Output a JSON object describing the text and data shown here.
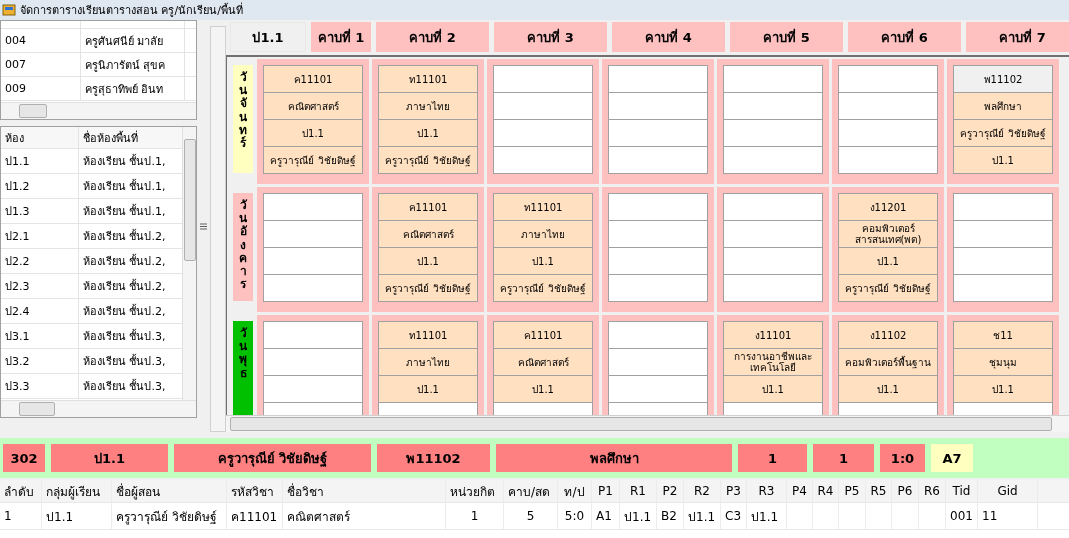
{
  "window": {
    "title": "จัดการตารางเรียนตารางสอน ครู/นักเรียน/พื้นที่"
  },
  "teachers": {
    "rows": [
      {
        "code": "004",
        "name": "ครูศันศนีย์ มาลัย"
      },
      {
        "code": "007",
        "name": "ครูนิภารัตน์ สุขค"
      },
      {
        "code": "009",
        "name": "ครูสุธาทิพย์ อินท"
      }
    ]
  },
  "rooms": {
    "columns": [
      "ห้อง",
      "ชื่อห้องพื้นที่"
    ],
    "rows": [
      {
        "code": "ป1.1",
        "name": "ห้องเรียน ชั้นป.1,"
      },
      {
        "code": "ป1.2",
        "name": "ห้องเรียน ชั้นป.1,"
      },
      {
        "code": "ป1.3",
        "name": "ห้องเรียน ชั้นป.1,"
      },
      {
        "code": "ป2.1",
        "name": "ห้องเรียน ชั้นป.2,"
      },
      {
        "code": "ป2.2",
        "name": "ห้องเรียน ชั้นป.2,"
      },
      {
        "code": "ป2.3",
        "name": "ห้องเรียน ชั้นป.2,"
      },
      {
        "code": "ป2.4",
        "name": "ห้องเรียน ชั้นป.2,"
      },
      {
        "code": "ป3.1",
        "name": "ห้องเรียน ชั้นป.3,"
      },
      {
        "code": "ป3.2",
        "name": "ห้องเรียน ชั้นป.3,"
      },
      {
        "code": "ป3.3",
        "name": "ห้องเรียน ชั้นป.3,"
      }
    ]
  },
  "timetable": {
    "group": "ป1.1",
    "periods": [
      "คาบที่ 1",
      "คาบที่ 2",
      "คาบที่ 3",
      "คาบที่ 4",
      "คาบที่ 5",
      "คาบที่ 6",
      "คาบที่ 7"
    ],
    "days": [
      {
        "label": "วันจันทร์",
        "color": "#ffffc0",
        "slots": [
          {
            "kind": "lesson",
            "selected": false,
            "lines": [
              "ค11101",
              "คณิตศาสตร์",
              "ป1.1",
              "ครูวารุณีย์ วิชัยดิษฐ์"
            ]
          },
          {
            "kind": "lesson",
            "selected": false,
            "lines": [
              "ท11101",
              "ภาษาไทย",
              "ป1.1",
              "ครูวารุณีย์ วิชัยดิษฐ์"
            ]
          },
          {
            "kind": "empty",
            "selected": false
          },
          {
            "kind": "empty",
            "selected": false
          },
          {
            "kind": "empty",
            "selected": false
          },
          {
            "kind": "empty",
            "selected": false
          },
          {
            "kind": "lesson",
            "selected": true,
            "lines": [
              "พ11102",
              "พลศึกษา",
              "ครูวารุณีย์ วิชัยดิษฐ์",
              "ป1.1"
            ]
          }
        ]
      },
      {
        "label": "วันอังคาร",
        "color": "#ffc0c0",
        "slots": [
          {
            "kind": "empty",
            "selected": false
          },
          {
            "kind": "lesson",
            "selected": false,
            "lines": [
              "ค11101",
              "คณิตศาสตร์",
              "ป1.1",
              "ครูวารุณีย์ วิชัยดิษฐ์"
            ]
          },
          {
            "kind": "lesson",
            "selected": false,
            "lines": [
              "ท11101",
              "ภาษาไทย",
              "ป1.1",
              "ครูวารุณีย์ วิชัยดิษฐ์"
            ]
          },
          {
            "kind": "empty",
            "selected": false
          },
          {
            "kind": "empty",
            "selected": false
          },
          {
            "kind": "lesson",
            "selected": false,
            "lines": [
              "ง11201",
              "คอมพิวเตอร์สารสนเทศ(พต)",
              "ป1.1",
              "ครูวารุณีย์ วิชัยดิษฐ์"
            ]
          },
          {
            "kind": "empty",
            "selected": false
          }
        ]
      },
      {
        "label": "วันพุธ",
        "color": "#00c000",
        "slots": [
          {
            "kind": "empty",
            "selected": false
          },
          {
            "kind": "lesson",
            "selected": false,
            "lines": [
              "ท11101",
              "ภาษาไทย",
              "ป1.1"
            ]
          },
          {
            "kind": "lesson",
            "selected": false,
            "lines": [
              "ค11101",
              "คณิตศาสตร์",
              "ป1.1"
            ]
          },
          {
            "kind": "empty",
            "selected": false
          },
          {
            "kind": "lesson",
            "selected": false,
            "lines": [
              "ง11101",
              "การงานอาชีพและเทคโนโลยี",
              "ป1.1"
            ]
          },
          {
            "kind": "lesson",
            "selected": false,
            "lines": [
              "ง11102",
              "คอมพิวเตอร์พื้นฐาน",
              "ป1.1"
            ]
          },
          {
            "kind": "lesson",
            "selected": false,
            "lines": [
              "ช11",
              "ชุมนุม",
              "ป1.1"
            ]
          }
        ]
      }
    ]
  },
  "summary": [
    {
      "text": "302",
      "color": "#ff8080"
    },
    {
      "text": "ป1.1",
      "color": "#ff8080"
    },
    {
      "text": "ครูวารุณีย์ วิชัยดิษฐ์",
      "color": "#ff8080"
    },
    {
      "text": "พ11102",
      "color": "#ff8080"
    },
    {
      "text": "พลศึกษา",
      "color": "#ff8080"
    },
    {
      "text": "1",
      "color": "#ff8080"
    },
    {
      "text": "1",
      "color": "#ff8080"
    },
    {
      "text": "1:0",
      "color": "#ff8080"
    },
    {
      "text": "A7",
      "color": "#ffffc0"
    }
  ],
  "table": {
    "columns": [
      "ลำดับ",
      "กลุ่มผู้เรียน",
      "ชื่อผู้สอน",
      "รหัสวิชา",
      "ชื่อวิชา",
      "หน่วยกิต",
      "คาบ/สด",
      "ท/ป",
      "P1",
      "R1",
      "P2",
      "R2",
      "P3",
      "R3",
      "P4",
      "R4",
      "P5",
      "R5",
      "P6",
      "R6",
      "Tid",
      "Gid"
    ],
    "rows": [
      [
        "1",
        "ป1.1",
        "ครูวารุณีย์ วิชัยดิษฐ์",
        "ค11101",
        "คณิตศาสตร์",
        "1",
        "5",
        "5:0",
        "A1",
        "ป1.1",
        "B2",
        "ป1.1",
        "C3",
        "ป1.1",
        null,
        null,
        null,
        null,
        null,
        null,
        "001",
        "11"
      ]
    ]
  }
}
